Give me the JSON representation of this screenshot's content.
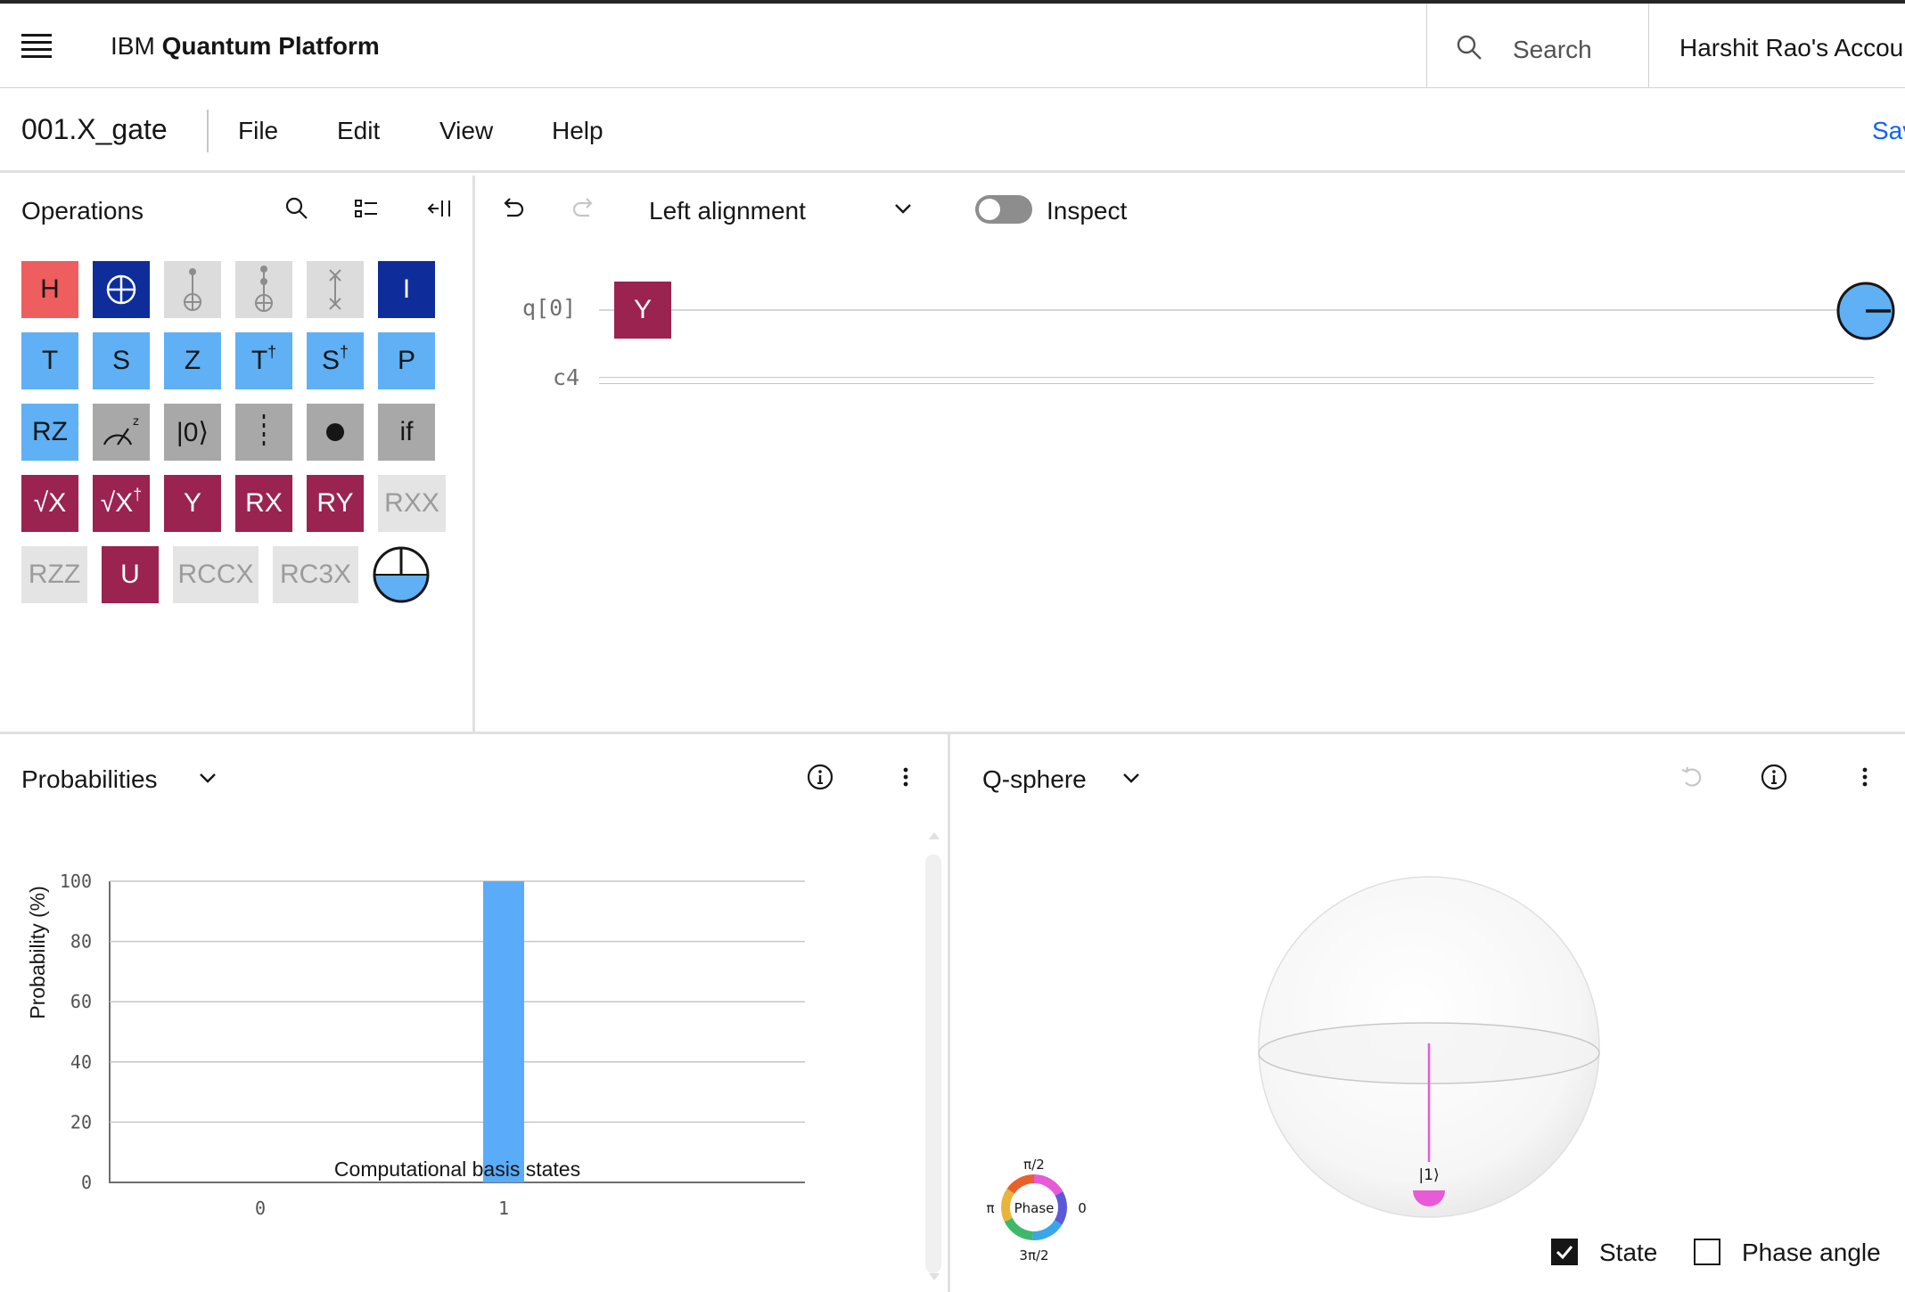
{
  "header": {
    "brand_prefix": "IBM",
    "brand_name": "Quantum Platform",
    "search_placeholder": "Search",
    "account_name": "Harshit Rao's Account"
  },
  "menubar": {
    "file_name": "001.X_gate",
    "items": [
      "File",
      "Edit",
      "View",
      "Help"
    ],
    "save_label": "Save"
  },
  "operations": {
    "title": "Operations",
    "icons": [
      "search-icon",
      "list-view-icon",
      "collapse-panel-icon"
    ],
    "gates": [
      {
        "label": "H",
        "kind": "red"
      },
      {
        "label": "",
        "kind": "navy",
        "icon": "cnot-icon"
      },
      {
        "label": "",
        "kind": "light-gray",
        "icon": "toffoli-icon"
      },
      {
        "label": "",
        "kind": "light-gray",
        "icon": "ccc-not-icon"
      },
      {
        "label": "",
        "kind": "light-gray",
        "icon": "swap-icon"
      },
      {
        "label": "I",
        "kind": "navy"
      },
      {
        "label": "T",
        "kind": "blue"
      },
      {
        "label": "S",
        "kind": "blue"
      },
      {
        "label": "Z",
        "kind": "blue"
      },
      {
        "label": "T",
        "sup": "†",
        "kind": "blue"
      },
      {
        "label": "S",
        "sup": "†",
        "kind": "blue"
      },
      {
        "label": "P",
        "kind": "blue"
      },
      {
        "label": "RZ",
        "kind": "blue"
      },
      {
        "label": "",
        "kind": "gray",
        "icon": "measure-z-icon"
      },
      {
        "label": "|0⟩",
        "kind": "gray"
      },
      {
        "label": "",
        "kind": "gray",
        "icon": "barrier-icon"
      },
      {
        "label": "",
        "kind": "gray",
        "icon": "control-dot-icon"
      },
      {
        "label": "if",
        "kind": "gray"
      },
      {
        "label": "√X",
        "kind": "wine"
      },
      {
        "label": "√X",
        "sup": "†",
        "kind": "wine"
      },
      {
        "label": "Y",
        "kind": "wine"
      },
      {
        "label": "RX",
        "kind": "wine"
      },
      {
        "label": "RY",
        "kind": "wine"
      },
      {
        "label": "RXX",
        "kind": "disabled"
      },
      {
        "label": "RZZ",
        "kind": "disabled"
      },
      {
        "label": "U",
        "kind": "wine"
      },
      {
        "label": "RCCX",
        "kind": "disabled"
      },
      {
        "label": "RC3X",
        "kind": "disabled"
      },
      {
        "label": "",
        "kind": "disk",
        "icon": "probability-disk-icon"
      }
    ]
  },
  "composer": {
    "alignment": "Left alignment",
    "inspect_label": "Inspect",
    "inspect_on": false,
    "qubit_label": "q[0]",
    "classical_label": "c4",
    "placed_gate": "Y"
  },
  "probabilities": {
    "title": "Probabilities"
  },
  "chart_data": {
    "type": "bar",
    "categories": [
      "0",
      "1"
    ],
    "values": [
      0,
      100
    ],
    "xlabel": "Computational basis states",
    "ylabel": "Probability (%)",
    "ylim": [
      0,
      100
    ],
    "yticks": [
      0,
      20,
      40,
      60,
      80,
      100
    ],
    "grid": true,
    "bar_color": "#5aacf8"
  },
  "qsphere": {
    "title": "Q-sphere",
    "state_label": "|1⟩",
    "state_color": "#e75ad8",
    "phase_wheel": {
      "center": "Phase",
      "top": "π/2",
      "left": "π",
      "right": "0",
      "bottom": "3π/2"
    },
    "state_checkbox": {
      "label": "State",
      "checked": true
    },
    "phase_checkbox": {
      "label": "Phase angle",
      "checked": false
    }
  }
}
